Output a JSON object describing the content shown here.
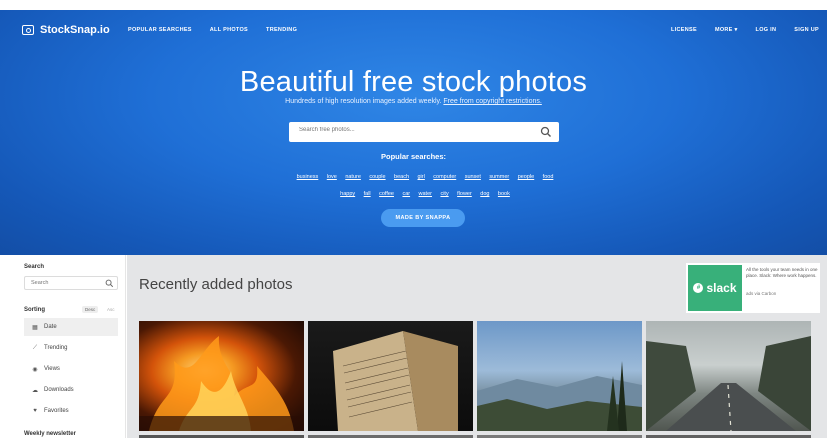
{
  "brand": {
    "name": "StockSnap.io"
  },
  "nav": {
    "left": [
      "POPULAR SEARCHES",
      "ALL PHOTOS",
      "TRENDING"
    ],
    "right": [
      "LICENSE",
      "MORE ▾",
      "LOG IN",
      "SIGN UP"
    ]
  },
  "hero": {
    "title": "Beautiful free stock photos",
    "subtitle_plain": "Hundreds of high resolution images added weekly.",
    "subtitle_link": "Free from copyright restrictions.",
    "search_placeholder": "Search free photos...",
    "popular_title": "Popular searches:",
    "tags": [
      "business",
      "love",
      "nature",
      "couple",
      "beach",
      "girl",
      "computer",
      "sunset",
      "summer",
      "people",
      "food",
      "happy",
      "fall",
      "coffee",
      "car",
      "water",
      "city",
      "flower",
      "dog",
      "book"
    ],
    "made_by_button": "MADE BY SNAPPA"
  },
  "sidebar": {
    "search_label": "Search",
    "search_placeholder": "Search",
    "sorting_label": "Sorting",
    "sort_desc": "Desc",
    "sort_asc": "Asc",
    "items": [
      {
        "label": "Date",
        "icon": "calendar-icon"
      },
      {
        "label": "Trending",
        "icon": "trending-icon"
      },
      {
        "label": "Views",
        "icon": "eye-icon"
      },
      {
        "label": "Downloads",
        "icon": "cloud-download-icon"
      },
      {
        "label": "Favorites",
        "icon": "heart-icon"
      }
    ],
    "newsletter_label": "Weekly newsletter"
  },
  "main": {
    "title": "Recently added photos",
    "ad": {
      "brand": "slack",
      "text": "All the tools your team needs in one place. Slack: Where work happens.",
      "via": "ads via Carbon"
    }
  },
  "colors": {
    "hero_blue": "#1f6fd6",
    "slack_green": "#38b07a"
  }
}
